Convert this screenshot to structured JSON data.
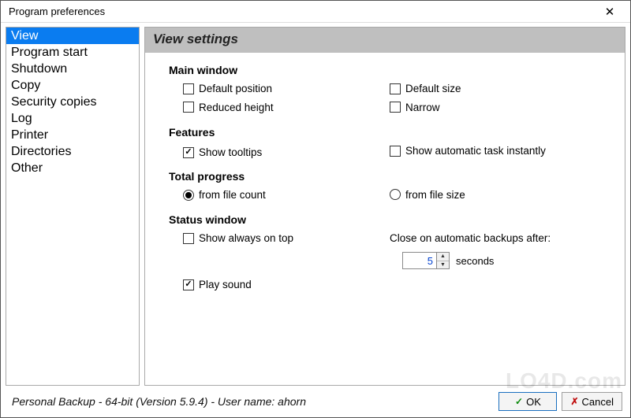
{
  "window": {
    "title": "Program preferences"
  },
  "sidebar": {
    "items": [
      {
        "label": "View",
        "selected": true
      },
      {
        "label": "Program start",
        "selected": false
      },
      {
        "label": "Shutdown",
        "selected": false
      },
      {
        "label": "Copy",
        "selected": false
      },
      {
        "label": "Security copies",
        "selected": false
      },
      {
        "label": "Log",
        "selected": false
      },
      {
        "label": "Printer",
        "selected": false
      },
      {
        "label": "Directories",
        "selected": false
      },
      {
        "label": "Other",
        "selected": false
      }
    ]
  },
  "content": {
    "heading": "View settings",
    "groups": {
      "main_window": {
        "title": "Main window",
        "default_position": {
          "label": "Default position",
          "checked": false
        },
        "default_size": {
          "label": "Default size",
          "checked": false
        },
        "reduced_height": {
          "label": "Reduced height",
          "checked": false
        },
        "narrow": {
          "label": "Narrow",
          "checked": false
        }
      },
      "features": {
        "title": "Features",
        "show_tooltips": {
          "label": "Show tooltips",
          "checked": true
        },
        "show_auto_task": {
          "label": "Show automatic task instantly",
          "checked": false
        }
      },
      "total_progress": {
        "title": "Total progress",
        "from_file_count": {
          "label": "from file count",
          "checked": true
        },
        "from_file_size": {
          "label": "from file size",
          "checked": false
        }
      },
      "status_window": {
        "title": "Status window",
        "show_always_on_top": {
          "label": "Show always on top",
          "checked": false
        },
        "play_sound": {
          "label": "Play sound",
          "checked": true
        },
        "close_after_label": "Close on automatic backups after:",
        "close_after_value": "5",
        "close_after_unit": "seconds"
      }
    }
  },
  "footer": {
    "status": "Personal Backup - 64-bit (Version 5.9.4) - User name: ahorn",
    "ok": "OK",
    "cancel": "Cancel"
  },
  "watermark": "LO4D.com"
}
